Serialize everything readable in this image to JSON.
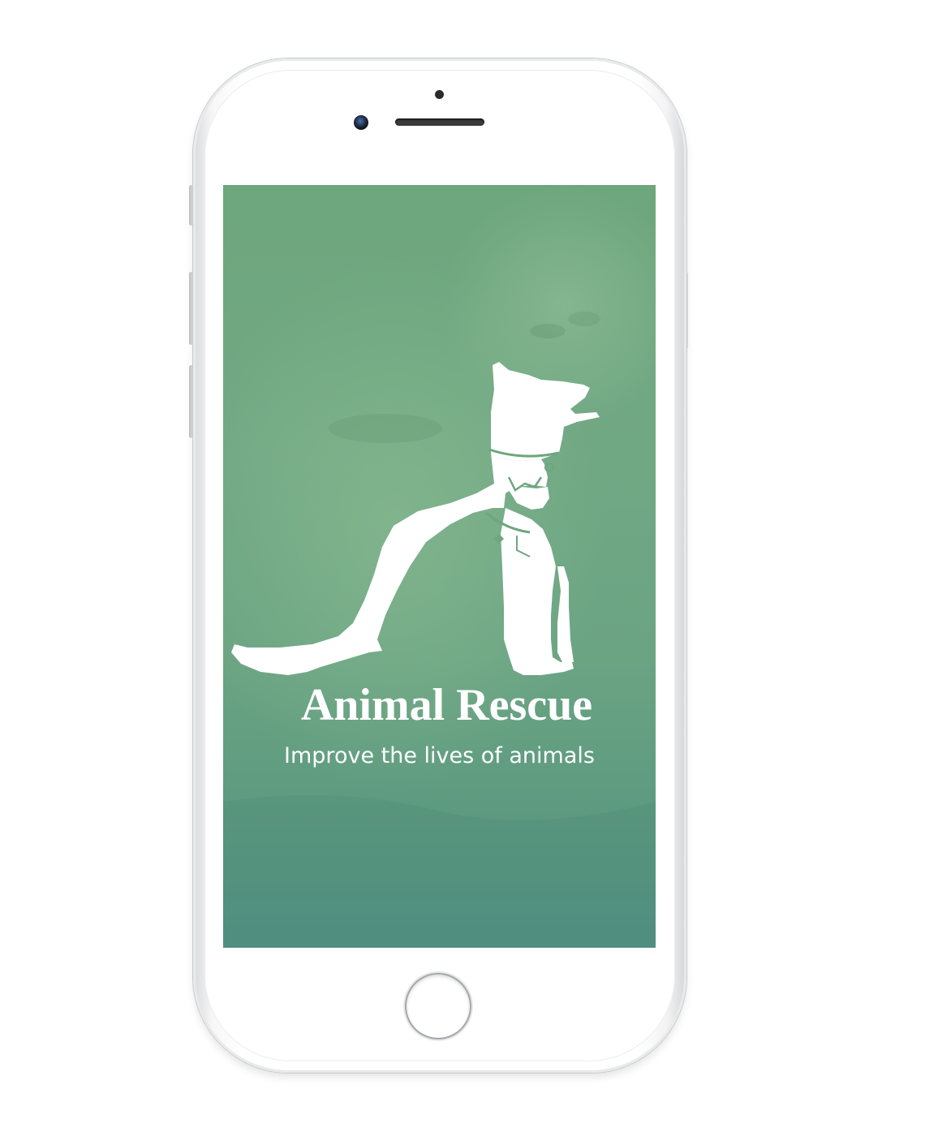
{
  "app": {
    "title": "Animal Rescue",
    "tagline": "Improve the lives of animals"
  },
  "device": {
    "type": "smartphone"
  },
  "icons": {
    "logo": "dog-and-cat-silhouette-icon"
  },
  "colors": {
    "screen_top": "#6ea67d",
    "screen_bottom": "#4f8f84",
    "text": "#ffffff"
  }
}
